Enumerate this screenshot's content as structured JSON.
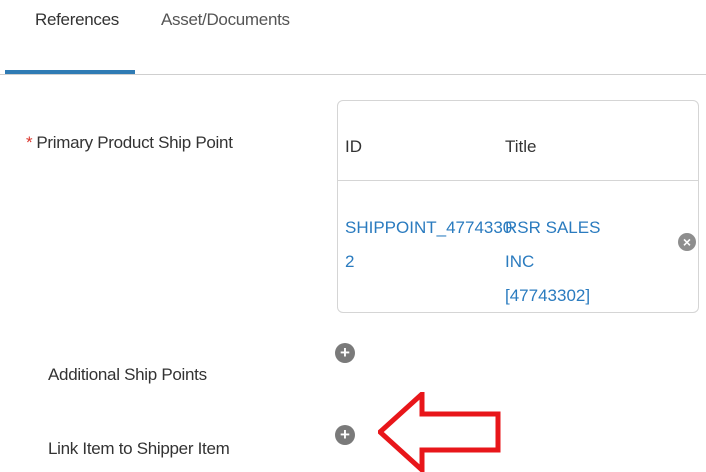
{
  "tabs": [
    {
      "label": "References",
      "active": true
    },
    {
      "label": "Asset/Documents",
      "active": false
    }
  ],
  "fields": {
    "primary_ship_point": {
      "required_marker": "*",
      "label": "Primary Product Ship Point",
      "table": {
        "columns": [
          "ID",
          "Title"
        ],
        "rows": [
          {
            "id_line1": "SHIPPOINT_4774330",
            "id_line2": "2",
            "title_line1": "RSR SALES INC",
            "title_line2": "[47743302]"
          }
        ]
      }
    },
    "additional_ship_points": {
      "label": "Additional Ship Points"
    },
    "link_shipper_item": {
      "label": "Link Item to Shipper Item"
    }
  },
  "icons": {
    "remove": "close-icon",
    "add": "plus-icon",
    "annotation": "red-arrow-left"
  },
  "colors": {
    "accent": "#2f7bb4",
    "link": "#2a7bbf",
    "required": "#d9342b",
    "annotation": "#e8161a",
    "icon_gray": "#7a7a7a"
  }
}
